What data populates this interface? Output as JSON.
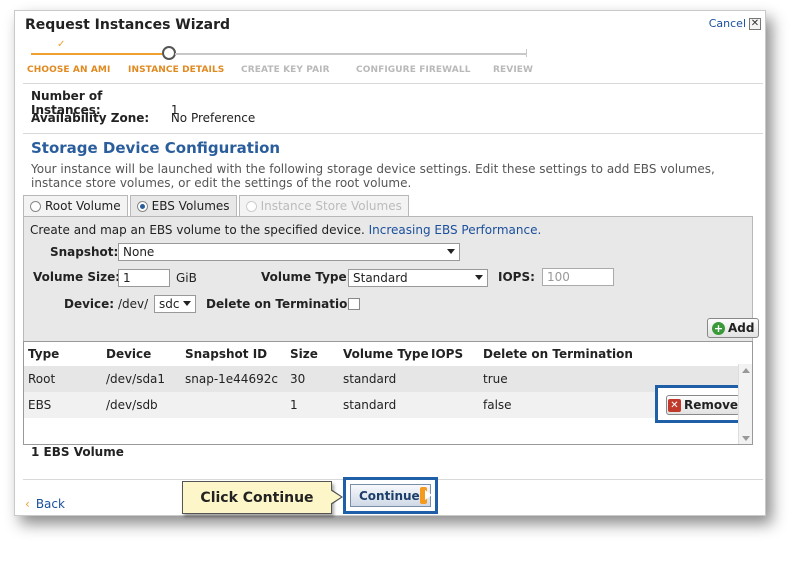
{
  "wizard": {
    "title": "Request Instances Wizard",
    "cancel_label": "Cancel"
  },
  "steps": [
    {
      "label": "CHOOSE AN AMI",
      "state": "done"
    },
    {
      "label": "INSTANCE DETAILS",
      "state": "active"
    },
    {
      "label": "CREATE KEY PAIR",
      "state": "todo"
    },
    {
      "label": "CONFIGURE FIREWALL",
      "state": "todo"
    },
    {
      "label": "REVIEW",
      "state": "todo"
    }
  ],
  "details": {
    "instances_label": "Number of Instances:",
    "instances_value": "1",
    "zone_label": "Availability Zone:",
    "zone_value": "No Preference"
  },
  "storage": {
    "title": "Storage Device Configuration",
    "description": "Your instance will be launched with the following storage device settings. Edit these settings to add EBS volumes, instance store volumes, or edit the settings of the root volume.",
    "tabs": [
      {
        "label": "Root Volume",
        "selected": false,
        "disabled": false
      },
      {
        "label": "EBS Volumes",
        "selected": true,
        "disabled": false
      },
      {
        "label": "Instance Store Volumes",
        "selected": false,
        "disabled": true
      }
    ],
    "intro": "Create and map an EBS volume to the specified device.",
    "intro_link": "Increasing EBS Performance.",
    "snapshot_label": "Snapshot:",
    "snapshot_value": "None",
    "volume_size_label": "Volume Size:",
    "volume_size_value": "1",
    "volume_size_unit": "GiB",
    "volume_type_label": "Volume Type:",
    "volume_type_value": "Standard",
    "iops_label": "IOPS:",
    "iops_placeholder": "100",
    "device_label": "Device:",
    "device_prefix": "/dev/",
    "device_value": "sdc",
    "delete_label": "Delete on Termination:",
    "delete_checked": false,
    "add_label": "Add"
  },
  "table": {
    "headers": [
      "Type",
      "Device",
      "Snapshot ID",
      "Size",
      "Volume Type",
      "IOPS",
      "Delete on Termination"
    ],
    "rows": [
      {
        "type": "Root",
        "device": "/dev/sda1",
        "snapshot": "snap-1e44692c",
        "size": "30",
        "volume_type": "standard",
        "iops": "",
        "delete": "true"
      },
      {
        "type": "EBS",
        "device": "/dev/sdb",
        "snapshot": "",
        "size": "1",
        "volume_type": "standard",
        "iops": "",
        "delete": "false"
      }
    ],
    "remove_label": "Remove",
    "count_text": "1 EBS Volume"
  },
  "footer": {
    "back_label": "Back",
    "continue_label": "Continue",
    "callout_text": "Click Continue"
  },
  "colors": {
    "accent_orange": "#f0a030",
    "link_blue": "#1a4f9c",
    "highlight_blue": "#1f5fa8",
    "section_title": "#2a5d9c"
  }
}
